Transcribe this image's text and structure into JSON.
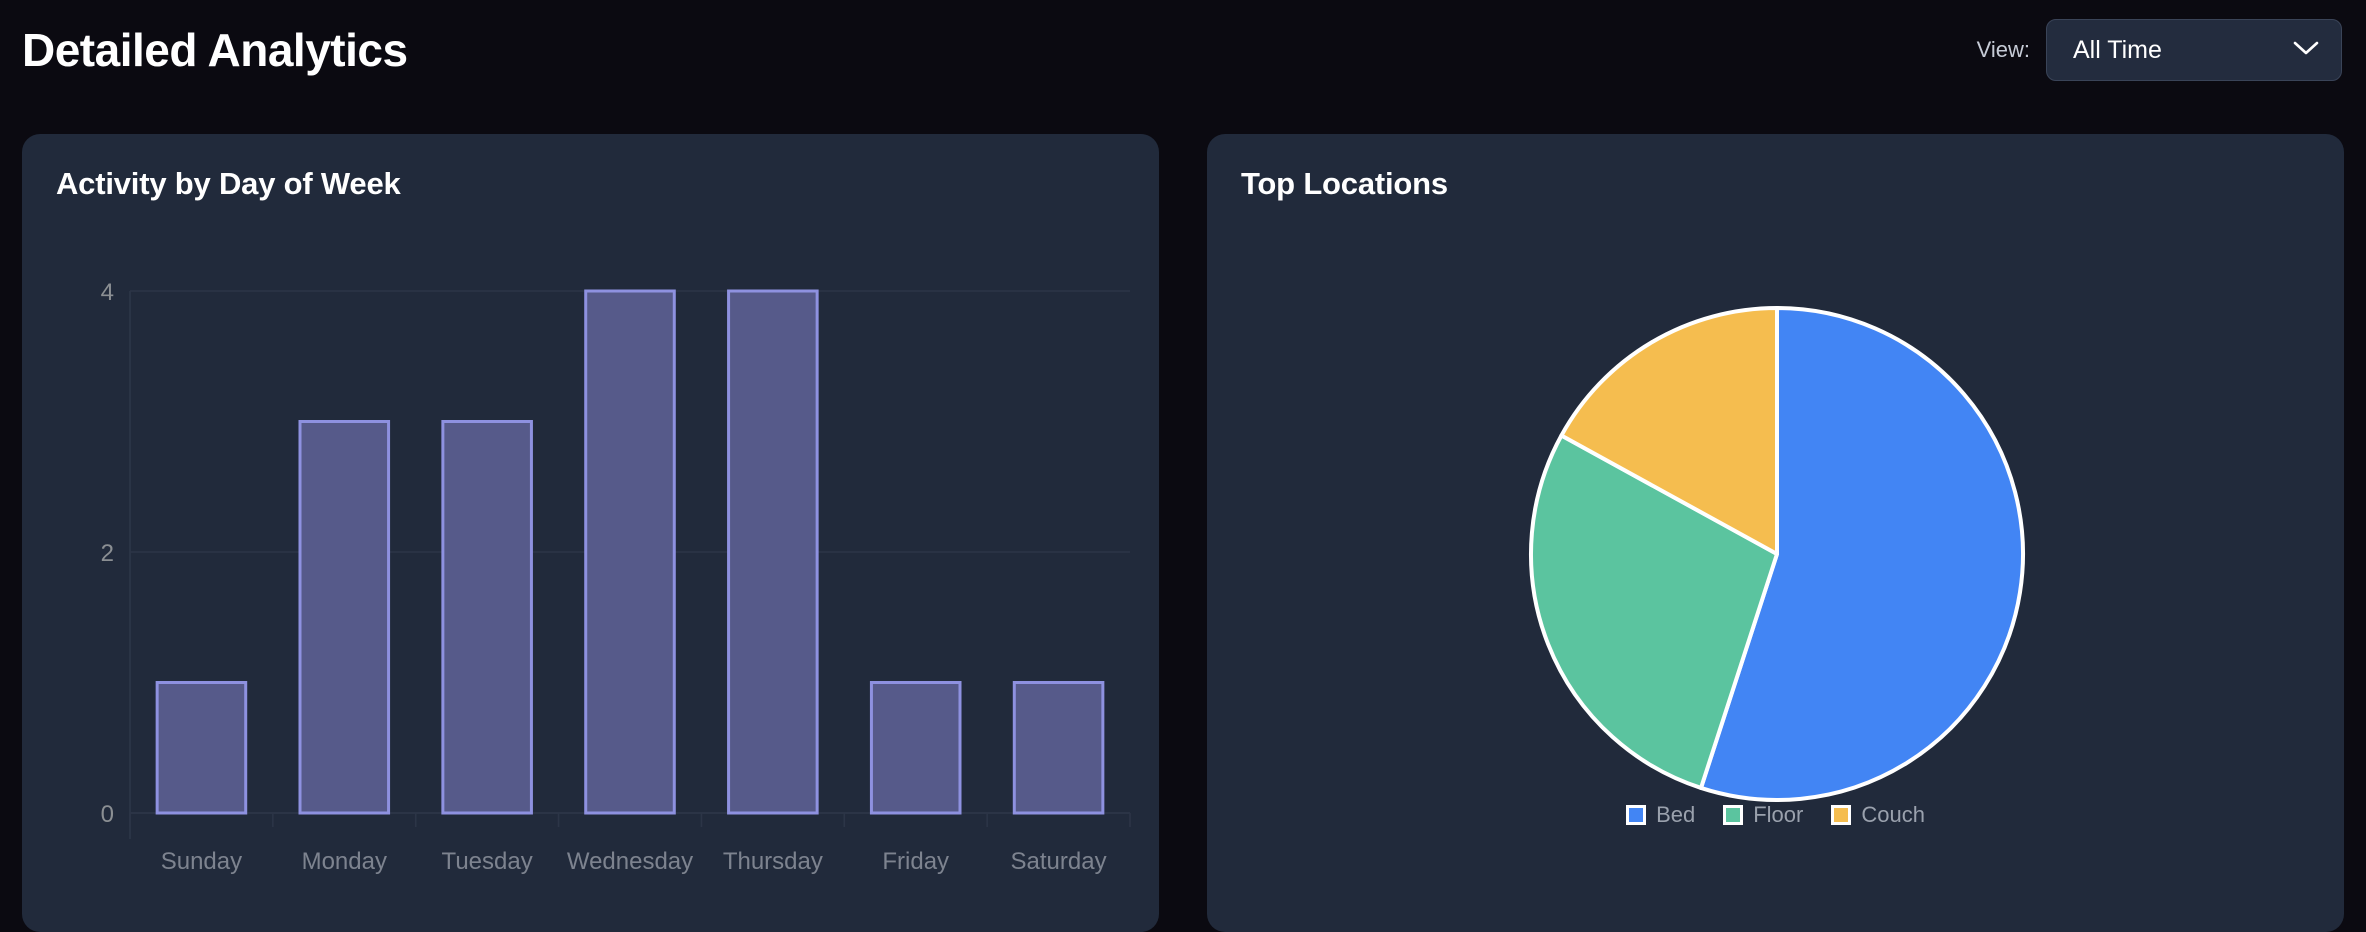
{
  "header": {
    "title": "Detailed Analytics",
    "view_label": "View:",
    "view_value": "All Time",
    "chevron_icon": "chevron-down-icon"
  },
  "colors": {
    "page_background": "#0b0a11",
    "card_background": "#212a3b",
    "bar_fill": "#565a8a",
    "bar_border": "#8e91e0",
    "grid": "#2c3547",
    "axis_text": "#7d838f",
    "tick_label": "#8b8f93",
    "pie_bed": "#4285f4",
    "pie_floor": "#5bc49f",
    "pie_couch": "#f5bd4f",
    "pie_stroke": "#ffffff",
    "legend_text": "#9aa1ad"
  },
  "cards": [
    {
      "id": "activity-by-day",
      "title": "Activity by Day of Week"
    },
    {
      "id": "top-locations",
      "title": "Top Locations"
    }
  ],
  "chart_data": [
    {
      "type": "bar",
      "title": "Activity by Day of Week",
      "categories": [
        "Sunday",
        "Monday",
        "Tuesday",
        "Wednesday",
        "Thursday",
        "Friday",
        "Saturday"
      ],
      "values": [
        1,
        3,
        3,
        4,
        4,
        1,
        1
      ],
      "xlabel": "",
      "ylabel": "",
      "ylim": [
        0,
        4
      ],
      "yticks": [
        0,
        2,
        4
      ],
      "ytick_labels": [
        "0",
        "2",
        "4"
      ],
      "grid": true,
      "legend": false
    },
    {
      "type": "pie",
      "title": "Top Locations",
      "labels": [
        "Bed",
        "Floor",
        "Couch"
      ],
      "values": [
        55,
        28,
        17
      ],
      "colors": [
        "#4285f4",
        "#5bc49f",
        "#f5bd4f"
      ],
      "legend": true,
      "legend_position": "bottom",
      "start_angle_deg": 0,
      "direction": "clockwise"
    }
  ]
}
